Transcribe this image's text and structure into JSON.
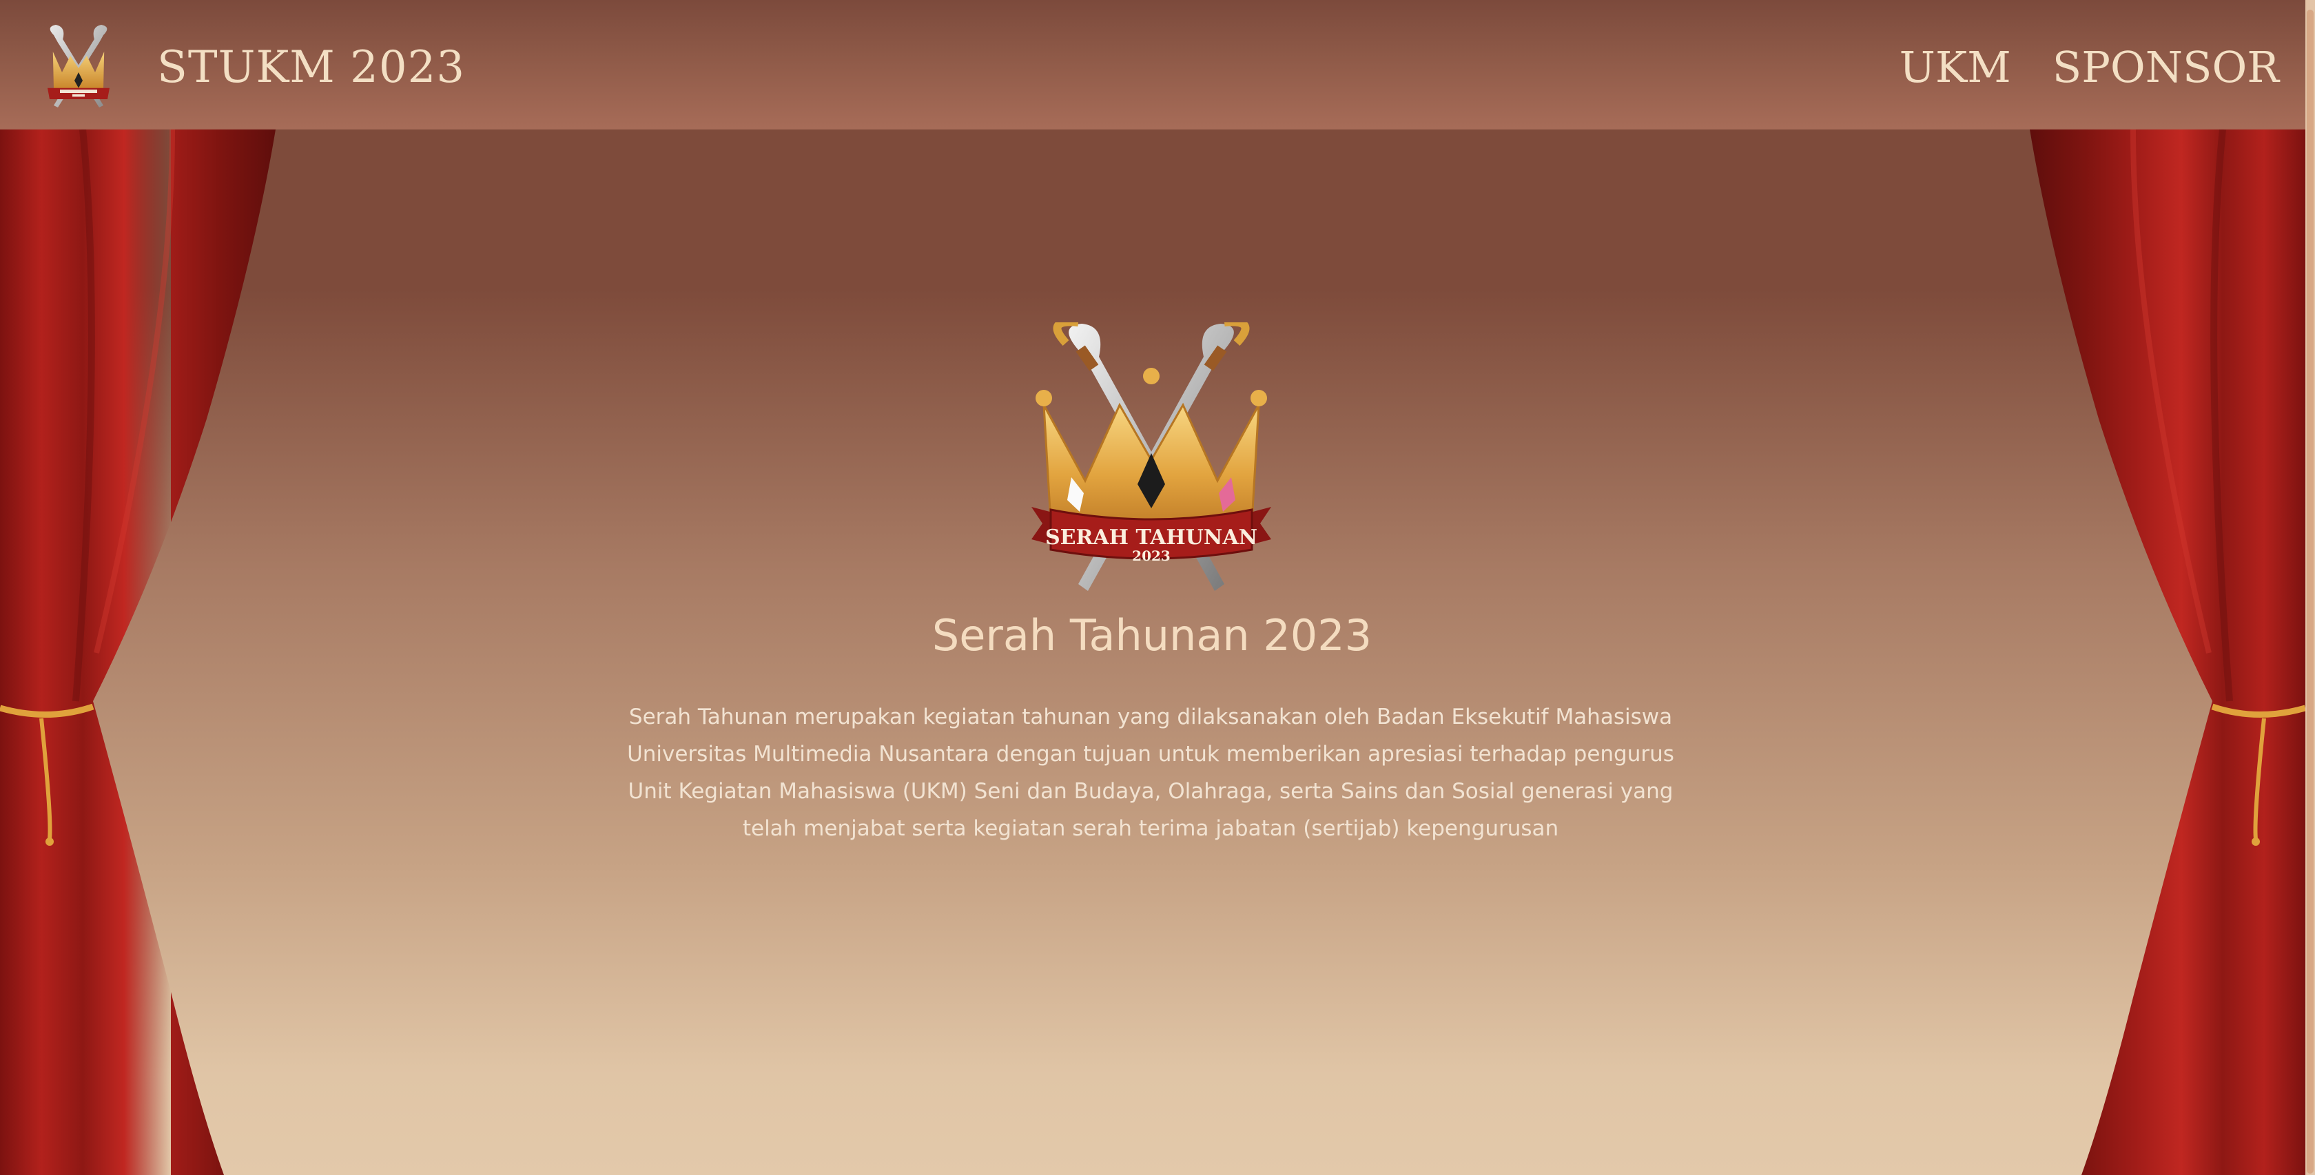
{
  "header": {
    "brand": "STUKM 2023",
    "logo_icon": "crown-swords-logo-icon",
    "nav": [
      {
        "label": "UKM"
      },
      {
        "label": "SPONSOR"
      }
    ]
  },
  "hero": {
    "logo_icon": "crown-swords-logo-icon",
    "logo_banner_text": "SERAH TAHUNAN",
    "logo_banner_year": "2023",
    "title": "Serah Tahunan 2023",
    "description": "Serah Tahunan merupakan kegiatan tahunan yang dilaksanakan oleh Badan Eksekutif Mahasiswa Universitas Multimedia Nusantara dengan tujuan untuk memberikan apresiasi terhadap pengurus Unit Kegiatan Mahasiswa (UKM) Seni dan Budaya, Olahraga, serta Sains dan Sosial generasi yang telah menjabat serta kegiatan serah terima jabatan (sertijab) kepengurusan"
  },
  "colors": {
    "header_top": "#7c4a3c",
    "header_bottom": "#a76c58",
    "nav_text": "#f3dfc4",
    "curtain_red": "#a61d1a",
    "gold": "#e0a23c",
    "background_bottom": "#e3c9aa"
  }
}
